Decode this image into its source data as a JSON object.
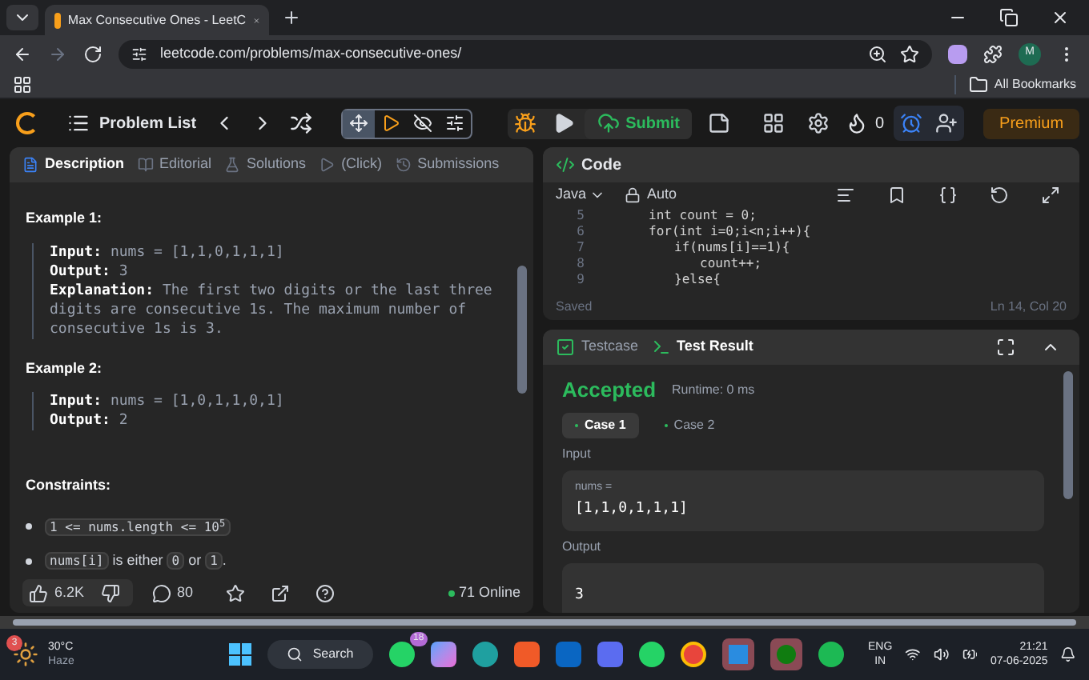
{
  "browser": {
    "tab_title": "Max Consecutive Ones - LeetC",
    "url": "leetcode.com/problems/max-consecutive-ones/",
    "profile": "M",
    "bookmarks": "All Bookmarks"
  },
  "nav": {
    "problem_list": "Problem List",
    "submit": "Submit",
    "streak": "0",
    "premium": "Premium"
  },
  "left_tabs": [
    {
      "label": "Description",
      "selected": true
    },
    {
      "label": "Editorial",
      "selected": false
    },
    {
      "label": "Solutions",
      "selected": false
    },
    {
      "label": "(Click)",
      "selected": false
    },
    {
      "label": "Submissions",
      "selected": false
    }
  ],
  "examples": [
    {
      "title": "Example 1:",
      "lines": [
        {
          "label": "Input:",
          "value": "nums = [1,1,0,1,1,1]"
        },
        {
          "label": "Output:",
          "value": "3"
        },
        {
          "label": "Explanation:",
          "value": "The first two digits or the last three digits are consecutive 1s. The maximum number of consecutive 1s is 3."
        }
      ]
    },
    {
      "title": "Example 2:",
      "lines": [
        {
          "label": "Input:",
          "value": "nums = [1,0,1,1,0,1]"
        },
        {
          "label": "Output:",
          "value": "2"
        }
      ]
    }
  ],
  "constraints": {
    "title": "Constraints:",
    "items": [
      [
        {
          "kind": "code",
          "text": "1 <= nums.length <= 10$^{5}$"
        }
      ],
      [
        {
          "kind": "code",
          "text": "nums[i]"
        },
        {
          "kind": "text",
          "text": " is either "
        },
        {
          "kind": "code",
          "text": "0"
        },
        {
          "kind": "text",
          "text": " or "
        },
        {
          "kind": "code",
          "text": "1"
        },
        {
          "kind": "text",
          "text": "."
        }
      ]
    ]
  },
  "footer": {
    "likes": "6.2K",
    "comments": "80",
    "online": "71 Online"
  },
  "code": {
    "title": "Code",
    "language": "Java",
    "mode": "Auto",
    "lines": [
      {
        "num": "5",
        "text": "int count = 0;"
      },
      {
        "num": "6",
        "text": "for(int i=0;i<n;i++){",
        "children": [
          {
            "num": "7",
            "text": "if(nums[i]==1){",
            "children": [
              {
                "num": "8",
                "text": "count++;"
              }
            ]
          },
          {
            "num": "9",
            "text": "}else{"
          }
        ]
      }
    ],
    "saved": "Saved",
    "cursor": "Ln 14, Col 20"
  },
  "result": {
    "tabs": [
      {
        "label": "Testcase",
        "selected": false
      },
      {
        "label": "Test Result",
        "selected": true
      }
    ],
    "status": "Accepted",
    "runtime": "Runtime: 0 ms",
    "cases": [
      {
        "label": "Case 1",
        "selected": true
      },
      {
        "label": "Case 2",
        "selected": false
      }
    ],
    "input_label": "Input",
    "var": "nums =",
    "input_value": "[1,1,0,1,1,1]",
    "output_label": "Output",
    "output_value": "3"
  },
  "taskbar": {
    "weather_badge": "3",
    "temp": "30°C",
    "weather": "Haze",
    "search": "Search",
    "whatsapp_badge": "18",
    "lang": "ENG",
    "region": "IN",
    "time": "21:21",
    "date": "07-06-2025"
  }
}
